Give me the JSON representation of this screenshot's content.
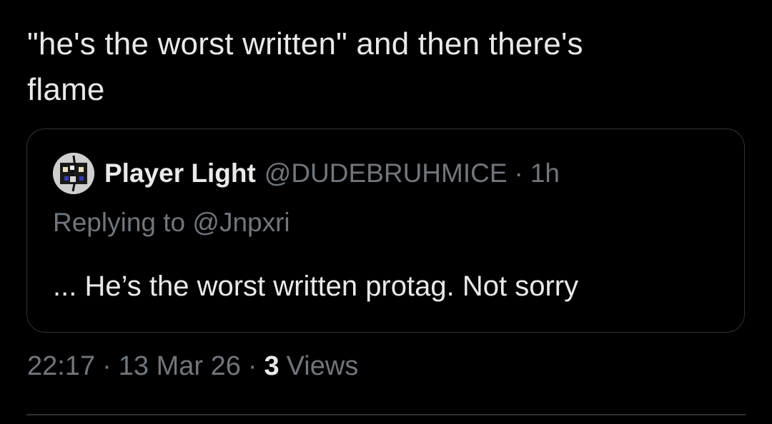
{
  "tweet": {
    "text_line1": "\"he's the worst written\" and then there's",
    "text_line2": "flame"
  },
  "quote": {
    "author_name": "Player Light",
    "author_handle": "@DUDEBRUHMICE",
    "separator": "·",
    "time_ago": "1h",
    "replying_to": "Replying to @Jnpxri",
    "body": "... He’s the worst written protag. Not sorry"
  },
  "meta": {
    "time": "22:17",
    "separator": "·",
    "date": "13 Mar 26",
    "views_count": "3",
    "views_label": "Views"
  },
  "colors": {
    "background": "#000000",
    "primary_text": "#e7e9ea",
    "secondary_text": "#71767b",
    "border": "#2f3336"
  }
}
